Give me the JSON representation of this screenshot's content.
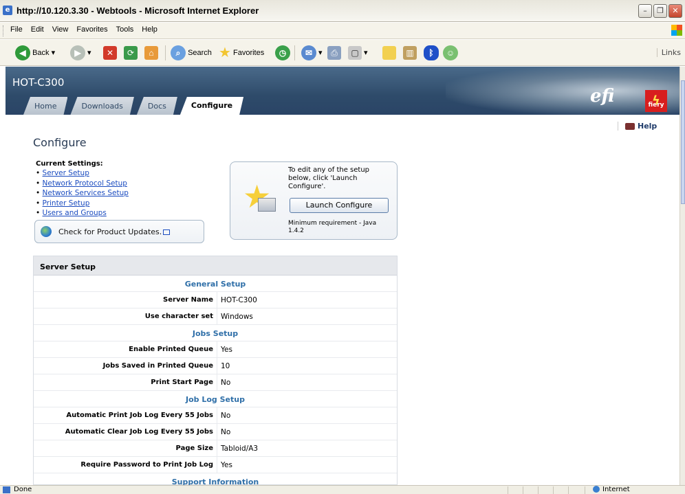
{
  "window": {
    "title": "http://10.120.3.30 - Webtools - Microsoft Internet Explorer",
    "min": "–",
    "max": "❐",
    "close": "✕"
  },
  "menu": [
    "File",
    "Edit",
    "View",
    "Favorites",
    "Tools",
    "Help"
  ],
  "toolbar": {
    "back": "Back",
    "search": "Search",
    "favorites": "Favorites",
    "links": "Links"
  },
  "banner": {
    "server_name": "HOT-C300",
    "logo_text": "efi",
    "logo_sub": "fiery"
  },
  "tabs": [
    "Home",
    "Downloads",
    "Docs",
    "Configure"
  ],
  "help_label": "Help",
  "page_title": "Configure",
  "current_settings": {
    "label": "Current Settings:",
    "links": [
      "Server Setup",
      "Network Protocol Setup",
      "Network Services Setup",
      "Printer Setup",
      "Users and Groups"
    ]
  },
  "update_box": {
    "label": "Check for Product Updates."
  },
  "launch_box": {
    "intro": "To edit any of the setup below, click 'Launch Configure'.",
    "button": "Launch Configure",
    "requirement": "Minimum requirement - Java 1.4.2"
  },
  "panel": {
    "header": "Server Setup",
    "sections": [
      {
        "title": "General Setup",
        "rows": [
          {
            "label": "Server Name",
            "value": "HOT-C300"
          },
          {
            "label": "Use character set",
            "value": "Windows"
          }
        ]
      },
      {
        "title": "Jobs Setup",
        "rows": [
          {
            "label": "Enable Printed Queue",
            "value": "Yes"
          },
          {
            "label": "Jobs Saved in Printed Queue",
            "value": "10"
          },
          {
            "label": "Print Start Page",
            "value": "No"
          }
        ]
      },
      {
        "title": "Job Log Setup",
        "rows": [
          {
            "label": "Automatic Print Job Log Every 55 Jobs",
            "value": "No"
          },
          {
            "label": "Automatic Clear Job Log Every 55 Jobs",
            "value": "No"
          },
          {
            "label": "Page Size",
            "value": "Tabloid/A3"
          },
          {
            "label": "Require Password to Print Job Log",
            "value": "Yes"
          }
        ]
      },
      {
        "title": "Support Information",
        "rows": []
      }
    ]
  },
  "status": {
    "left": "Done",
    "zone": "Internet"
  }
}
